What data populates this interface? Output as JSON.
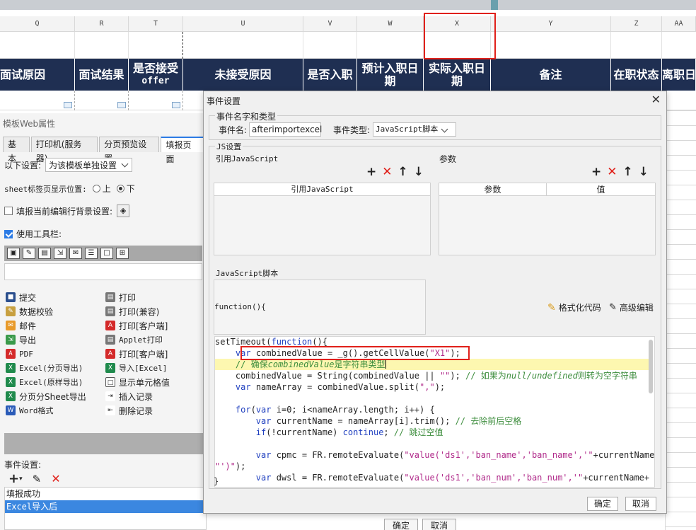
{
  "sheet": {
    "columns": [
      {
        "letter": "Q",
        "header": "面试原因"
      },
      {
        "letter": "R",
        "header": "面试结果"
      },
      {
        "letter": "T",
        "header": "是否接受",
        "header2": "offer"
      },
      {
        "letter": "U",
        "header": "未接受原因"
      },
      {
        "letter": "V",
        "header": "是否入职"
      },
      {
        "letter": "W",
        "header": "预计入职日",
        "header2": "期"
      },
      {
        "letter": "X",
        "header": "实际入职日",
        "header2": "期"
      },
      {
        "letter": "Y",
        "header": "备注"
      },
      {
        "letter": "Z",
        "header": "在职状态"
      },
      {
        "letter": "AA",
        "header": "离职日"
      }
    ]
  },
  "web_props": {
    "title": "模板Web属性",
    "tabs": [
      "基本",
      "打印机(服务器)",
      "分页预览设置",
      "填报页面"
    ],
    "settings_label": "以下设置:",
    "settings_value": "为该模板单独设置",
    "sheet_tab_label": "sheet标签页显示位置:",
    "radio_top": "上",
    "radio_bottom": "下",
    "bg_label": "填报当前编辑行背景设置:",
    "toolbar_label": "使用工具栏:",
    "buttons_col1": [
      "提交",
      "数据校验",
      "邮件",
      "导出",
      "PDF",
      "Excel(分页导出)",
      "Excel(原样导出)",
      "分页分Sheet导出",
      "Word格式"
    ],
    "buttons_col2": [
      "打印",
      "打印(兼容)",
      "打印[客户端]",
      "Applet打印",
      "打印[客户端]",
      "导入[Excel]",
      "显示单元格值",
      "插入记录",
      "删除记录"
    ],
    "events_label": "事件设置:",
    "events": [
      "填报成功",
      "Excel导入后"
    ],
    "ok": "确定",
    "cancel": "取消"
  },
  "dialog": {
    "title": "事件设置",
    "group_name_type": "事件名字和类型",
    "event_name_label": "事件名:",
    "event_name_value": "afterimportexcel",
    "event_type_label": "事件类型:",
    "event_type_value": "JavaScript脚本",
    "group_js": "JS设置",
    "ref_js_label": "引用JavaScript",
    "params_label": "参数",
    "ref_js_col": "引用JavaScript",
    "param_col": "参数",
    "value_col": "值",
    "script_label": "JavaScript脚本",
    "function_sig": "function(){",
    "format_code": "格式化代码",
    "advanced_edit": "高级编辑",
    "code_lines": [
      {
        "parts": [
          [
            "",
            "setTimeout("
          ],
          [
            "kw",
            "function"
          ],
          [
            "",
            "(){"
          ]
        ]
      },
      {
        "parts": [
          [
            "",
            "    "
          ],
          [
            "kw",
            "var"
          ],
          [
            "",
            " combinedValue = _g().getCellValue("
          ],
          [
            "str",
            "\"X1\""
          ],
          [
            "",
            ");"
          ]
        ]
      },
      {
        "parts": [
          [
            "",
            "    "
          ],
          [
            "cmt",
            "// 确保"
          ],
          [
            "cmti",
            "combinedValue"
          ],
          [
            "cmt",
            "是字符串类型"
          ]
        ],
        "highlight": true,
        "caret": true
      },
      {
        "parts": [
          [
            "",
            "    combinedValue = String(combinedValue || "
          ],
          [
            "str",
            "\"\""
          ],
          [
            "",
            "); "
          ],
          [
            "cmt",
            "// 如果为"
          ],
          [
            "cmti",
            "null/undefined"
          ],
          [
            "cmt",
            "则转为空字符串"
          ]
        ]
      },
      {
        "parts": [
          [
            "",
            "    "
          ],
          [
            "kw",
            "var"
          ],
          [
            "",
            " nameArray = combinedValue.split("
          ],
          [
            "str",
            "\",\""
          ],
          [
            "",
            ");"
          ]
        ]
      },
      {
        "parts": [
          [
            "",
            ""
          ]
        ]
      },
      {
        "parts": [
          [
            "",
            "    "
          ],
          [
            "kw",
            "for"
          ],
          [
            "",
            "("
          ],
          [
            "kw",
            "var"
          ],
          [
            "",
            " i=0; i<nameArray.length; i++) {"
          ]
        ]
      },
      {
        "parts": [
          [
            "",
            "        "
          ],
          [
            "kw",
            "var"
          ],
          [
            "",
            " currentName = nameArray[i].trim(); "
          ],
          [
            "cmt",
            "// 去除前后空格"
          ]
        ]
      },
      {
        "parts": [
          [
            "",
            "        "
          ],
          [
            "kw",
            "if"
          ],
          [
            "",
            "(!currentName) "
          ],
          [
            "kw",
            "continue"
          ],
          [
            "",
            "; "
          ],
          [
            "cmt",
            "// 跳过空值"
          ]
        ]
      },
      {
        "parts": [
          [
            "",
            ""
          ]
        ]
      },
      {
        "parts": [
          [
            "",
            "        "
          ],
          [
            "kw",
            "var"
          ],
          [
            "",
            " cpmc = FR.remoteEvaluate("
          ],
          [
            "str",
            "\"value('ds1','ban_name','ban_name','\""
          ],
          [
            "",
            "+currentName+"
          ]
        ]
      },
      {
        "parts": [
          [
            "str",
            "\"')\""
          ],
          [
            "",
            ");"
          ]
        ]
      },
      {
        "parts": [
          [
            "",
            "        "
          ],
          [
            "kw",
            "var"
          ],
          [
            "",
            " dwsl = FR.remoteEvaluate("
          ],
          [
            "str",
            "\"value('ds1','ban_num','ban_num','\""
          ],
          [
            "",
            "+currentName+"
          ]
        ]
      }
    ],
    "closing_brace": "}",
    "ok": "确定",
    "cancel": "取消"
  }
}
